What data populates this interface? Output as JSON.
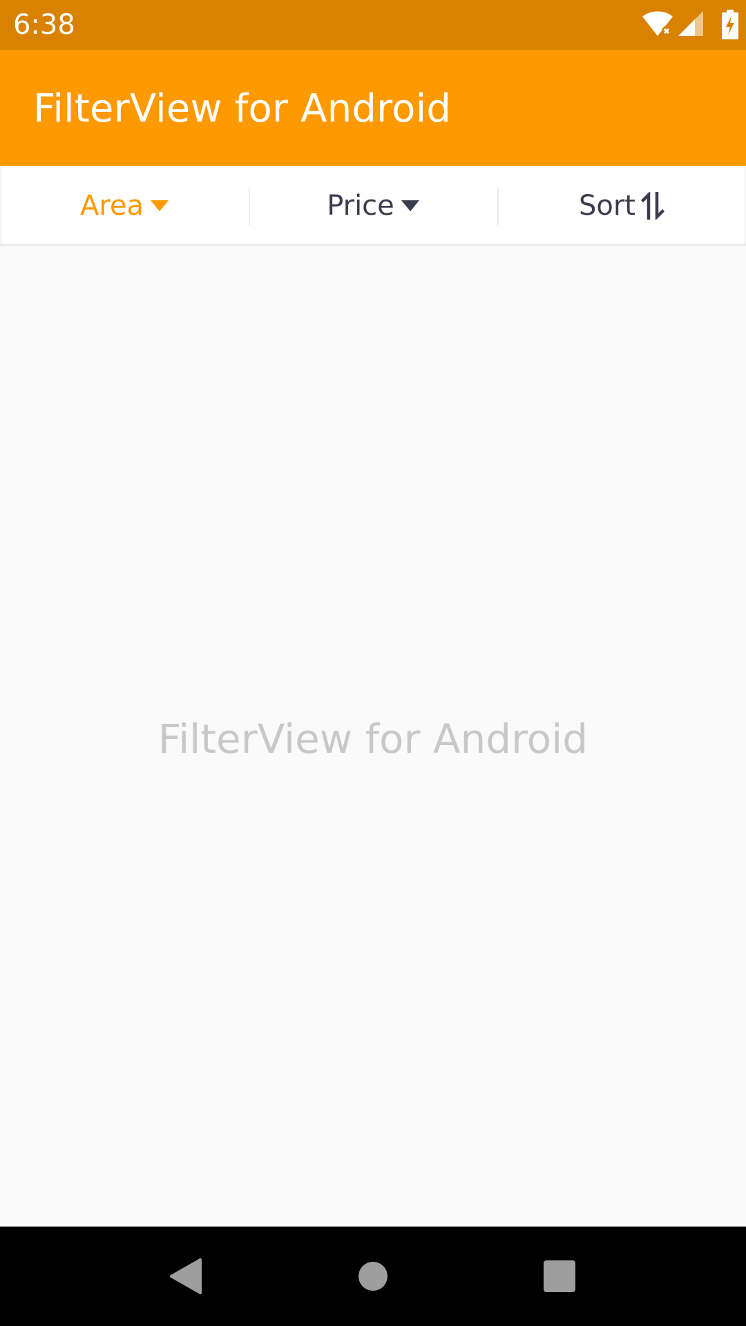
{
  "status_bar": {
    "time": "6:38",
    "icons": [
      "wifi-off-icon",
      "signal-icon",
      "battery-charging-icon"
    ]
  },
  "app_bar": {
    "title": "FilterView for Android",
    "color": "#ff9900"
  },
  "filters": [
    {
      "label": "Area",
      "icon": "caret-down-icon",
      "active": true
    },
    {
      "label": "Price",
      "icon": "caret-down-icon",
      "active": false
    },
    {
      "label": "Sort",
      "icon": "sort-icon",
      "active": false
    }
  ],
  "content": {
    "placeholder_text": "FilterView for Android"
  },
  "nav_bar": {
    "buttons": [
      "back-icon",
      "home-icon",
      "recents-icon"
    ]
  },
  "colors": {
    "accent": "#ff9900",
    "status_bar": "#d98200",
    "inactive_text": "#3c3c4e"
  }
}
